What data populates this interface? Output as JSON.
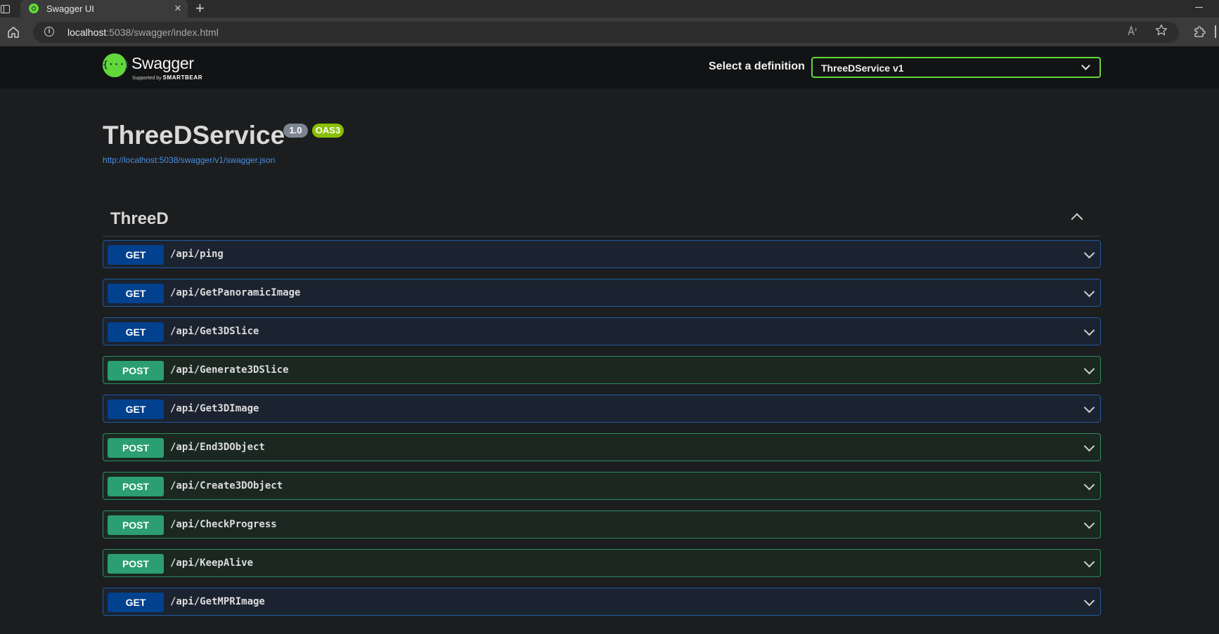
{
  "browser": {
    "tab_title": "Swagger UI",
    "tab_close": "×",
    "new_tab": "+",
    "url_host": "localhost",
    "url_rest": ":5038/swagger/index.html"
  },
  "swagger": {
    "logo_mark": "{···}",
    "logo_text": "Swagger",
    "logo_sub": "Supported by",
    "logo_sub_brand": "SMARTBEAR",
    "definition_label": "Select a definition",
    "definition_value": "ThreeDService v1"
  },
  "info": {
    "title": "ThreeDService",
    "version": "1.0",
    "oas": "OAS3",
    "spec_url": "http://localhost:5038/swagger/v1/swagger.json"
  },
  "tag": {
    "name": "ThreeD"
  },
  "operations": [
    {
      "method": "GET",
      "path": "/api/ping"
    },
    {
      "method": "GET",
      "path": "/api/GetPanoramicImage"
    },
    {
      "method": "GET",
      "path": "/api/Get3DSlice"
    },
    {
      "method": "POST",
      "path": "/api/Generate3DSlice"
    },
    {
      "method": "GET",
      "path": "/api/Get3DImage"
    },
    {
      "method": "POST",
      "path": "/api/End3DObject"
    },
    {
      "method": "POST",
      "path": "/api/Create3DObject"
    },
    {
      "method": "POST",
      "path": "/api/CheckProgress"
    },
    {
      "method": "POST",
      "path": "/api/KeepAlive"
    },
    {
      "method": "GET",
      "path": "/api/GetMPRImage"
    }
  ],
  "colors": {
    "get_accent": "#02418e",
    "post_accent": "#2b9e72",
    "swagger_green": "#62d73a",
    "link": "#4990e2"
  }
}
